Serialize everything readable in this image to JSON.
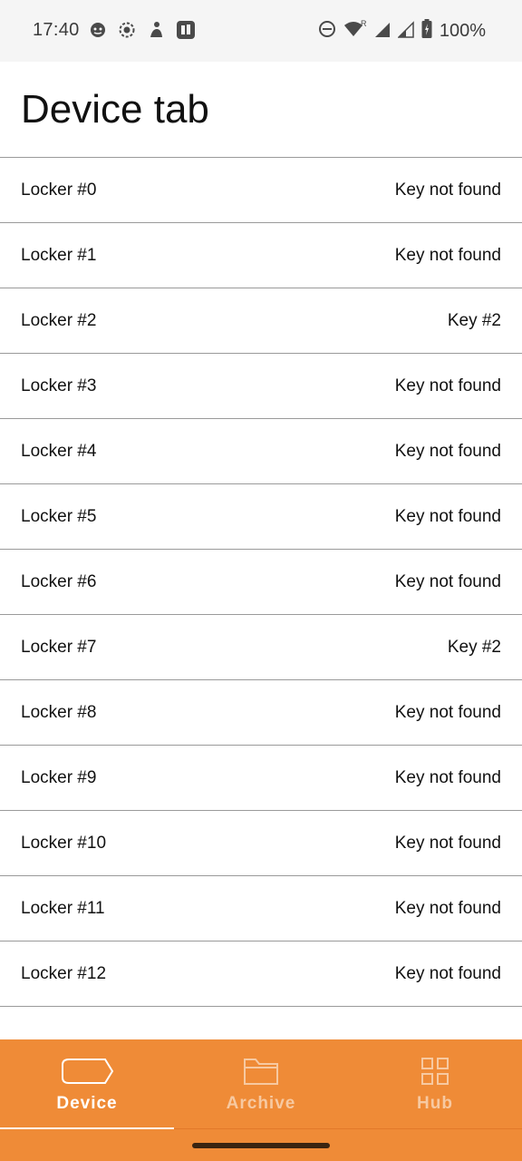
{
  "status_bar": {
    "time": "17:40",
    "battery": "100%",
    "icons": [
      "face-icon",
      "record-icon",
      "figure-icon",
      "app-icon",
      "dnd-icon",
      "wifi-icon",
      "roaming-icon",
      "signal-icon",
      "battery-icon"
    ]
  },
  "header": {
    "title": "Device tab"
  },
  "lockers": [
    {
      "name": "Locker #0",
      "status": "Key not found"
    },
    {
      "name": "Locker #1",
      "status": "Key not found"
    },
    {
      "name": "Locker #2",
      "status": "Key #2"
    },
    {
      "name": "Locker #3",
      "status": "Key not found"
    },
    {
      "name": "Locker #4",
      "status": "Key not found"
    },
    {
      "name": "Locker #5",
      "status": "Key not found"
    },
    {
      "name": "Locker #6",
      "status": "Key not found"
    },
    {
      "name": "Locker #7",
      "status": "Key #2"
    },
    {
      "name": "Locker #8",
      "status": "Key not found"
    },
    {
      "name": "Locker #9",
      "status": "Key not found"
    },
    {
      "name": "Locker #10",
      "status": "Key not found"
    },
    {
      "name": "Locker #11",
      "status": "Key not found"
    },
    {
      "name": "Locker #12",
      "status": "Key not found"
    }
  ],
  "bottom_nav": {
    "tabs": [
      {
        "label": "Device",
        "icon": "device-icon",
        "active": true
      },
      {
        "label": "Archive",
        "icon": "folder-icon",
        "active": false
      },
      {
        "label": "Hub",
        "icon": "grid-icon",
        "active": false
      }
    ]
  },
  "colors": {
    "accent": "#ef8b37",
    "divider": "#9a9a9a",
    "status_bar_bg": "#f5f5f5"
  }
}
